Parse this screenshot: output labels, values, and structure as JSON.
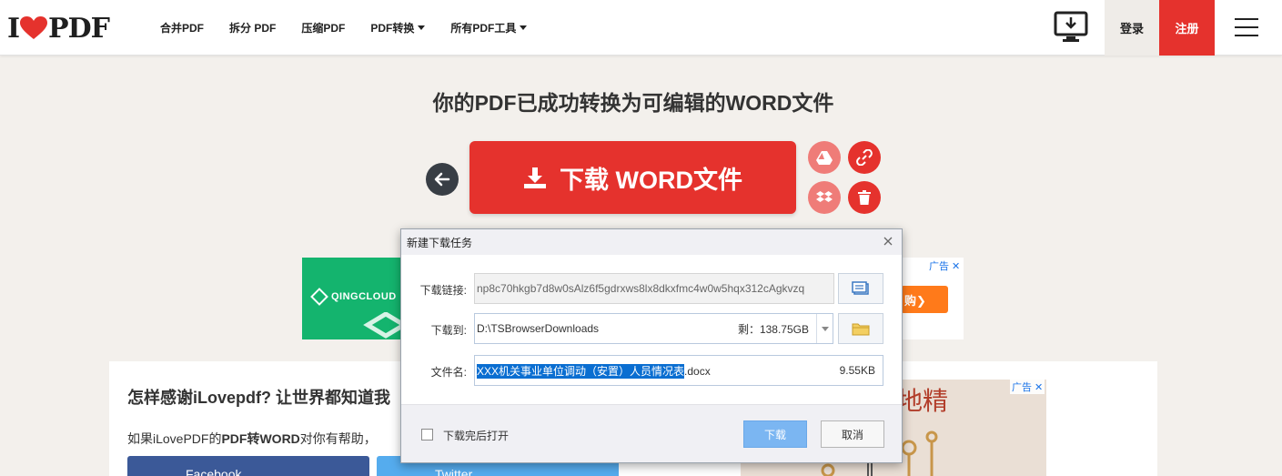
{
  "header": {
    "logo_left": "I",
    "logo_right": "PDF",
    "nav": [
      {
        "label": "合并PDF",
        "has_caret": false
      },
      {
        "label": "拆分 PDF",
        "has_caret": false
      },
      {
        "label": "压缩PDF",
        "has_caret": false
      },
      {
        "label": "PDF转换",
        "has_caret": true
      },
      {
        "label": "所有PDF工具",
        "has_caret": true
      }
    ],
    "login": "登录",
    "register": "注册"
  },
  "main": {
    "title": "你的PDF已成功转换为可编辑的WORD文件",
    "download_label": "下载 WORD文件"
  },
  "ads": {
    "top": {
      "brand": "QINGCLOUD",
      "cta": "购❯",
      "tag": "广告"
    },
    "right": {
      "text": "地精",
      "tag": "广告"
    }
  },
  "share": {
    "title": "怎样感谢iLovepdf? 让世界都知道我",
    "desc_prefix": "如果iLovePDF的",
    "desc_bold": "PDF转WORD",
    "desc_suffix": "对你有帮助，",
    "facebook": "Facebook",
    "twitter": "Twitter"
  },
  "dialog": {
    "title": "新建下载任务",
    "link_label": "下载链接:",
    "link_value": "np8c70hkgb7d8w0sAlz6f5gdrxws8lx8dkxfmc4w0w5hqx312cAgkvzq",
    "dest_label": "下载到:",
    "dest_value": "D:\\TSBrowserDownloads",
    "free_space": "剩：138.75GB",
    "name_label": "文件名:",
    "name_selected": "XXX机关事业单位调动（安置）人员情况表",
    "name_ext": ".docx",
    "size": "9.55KB",
    "open_after": "下载完后打开",
    "open_after_checked": false,
    "download_btn": "下载",
    "cancel_btn": "取消"
  },
  "colors": {
    "brand_red": "#e5322d",
    "page_bg": "#f3f0ec",
    "selection_blue": "#0a6ed1"
  }
}
